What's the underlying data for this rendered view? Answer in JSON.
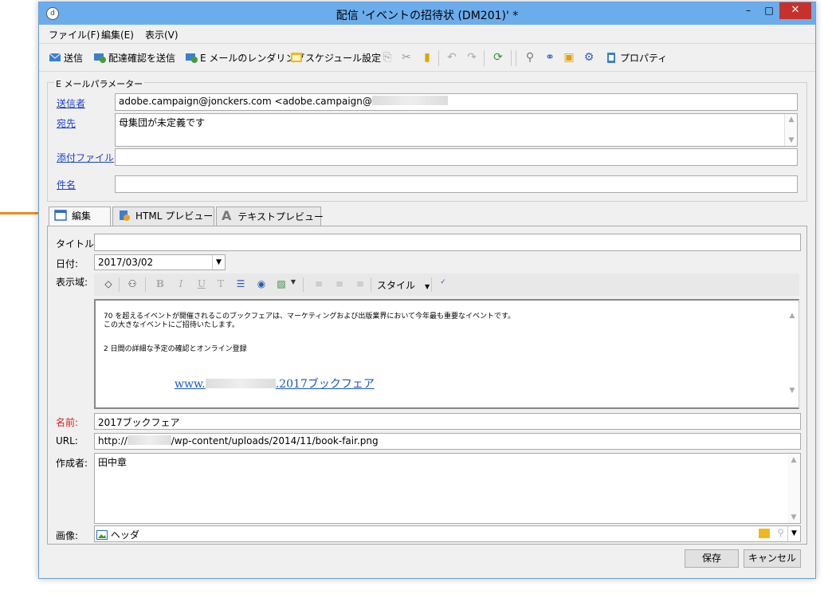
{
  "window": {
    "title": "配信 'イベントの招待状 (DM201)' *",
    "minimize": "–",
    "maximize": "□",
    "close": "✕",
    "app_icon": "d"
  },
  "menu": {
    "file": "ファイル(F)",
    "edit": "編集(E)",
    "view": "表示(V)"
  },
  "toolbar": {
    "send": "送信",
    "send_proof": "配達確認を送信",
    "email_rendering": "E メールのレンダリング",
    "schedule": "スケジュール設定",
    "properties": "プロパティ"
  },
  "params": {
    "legend": "E メールパラメーター",
    "from_label": "送信者",
    "from_value": "adobe.campaign@jonckers.com <adobe.campaign@",
    "to_label": "宛先",
    "to_value": "母集団が未定義です",
    "attachment_label": "添付ファイル",
    "attachment_value": "",
    "subject_label": "件名",
    "subject_value": ""
  },
  "tabs": {
    "edit": "編集",
    "html_preview": "HTML プレビュー",
    "text_preview": "テキストプレビュー"
  },
  "form": {
    "title_label": "タイトル:",
    "title_value": "",
    "date_label": "日付:",
    "date_value": "2017/03/02",
    "display_label": "表示域:",
    "style_label": "スタイル",
    "name_label": "名前:",
    "name_value": "2017ブックフェア",
    "url_label": "URL:",
    "url_prefix": "http://",
    "url_suffix": "/wp-content/uploads/2014/11/book-fair.png",
    "author_label": "作成者:",
    "author_value": "田中章",
    "image_label": "画像:",
    "image_value": "ヘッダ"
  },
  "editor": {
    "line1": "70 を超えるイベントが開催されるこのブックフェアは、マーケティングおよび出版業界において今年最も重要なイベントです。",
    "line2": "この大きなイベントにご招待いたします。",
    "line3": "2 日間の詳細な予定の確認とオンライン登録",
    "link_prefix": "www.",
    "link_suffix": ".2017ブックフェア"
  },
  "footer": {
    "save": "保存",
    "cancel": "キャンセル"
  },
  "colors": {
    "titlebar": "#6badec",
    "close": "#c7312b",
    "link": "#1a3fd0",
    "required_label": "#d02020",
    "pointer_arrow": "#f08a1c"
  }
}
